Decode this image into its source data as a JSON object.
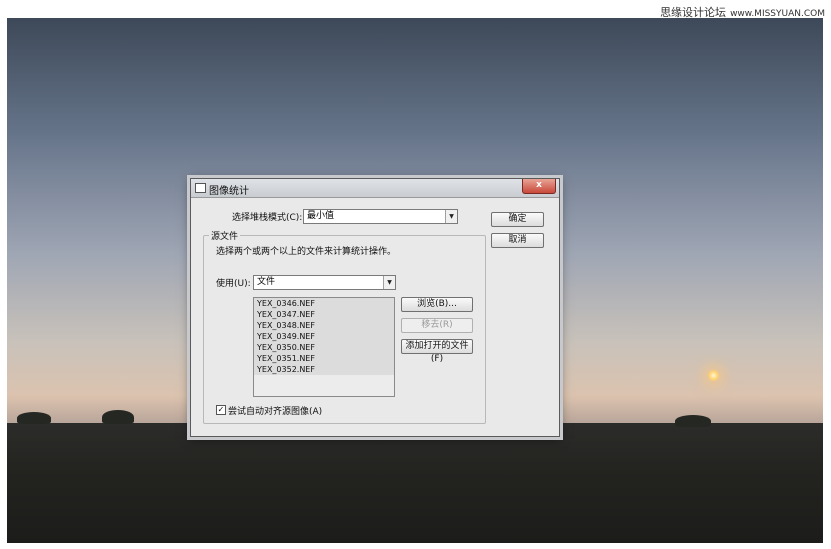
{
  "watermark": {
    "text": "思缘设计论坛",
    "site": "www.MISSYUAN.COM"
  },
  "dialog": {
    "title": "图像统计",
    "close_label": "x",
    "stack_mode_label": "选择堆栈模式(C):",
    "stack_mode_value": "最小值",
    "ok_label": "确定",
    "cancel_label": "取消",
    "source_group_title": "源文件",
    "source_hint": "选择两个或两个以上的文件来计算统计操作。",
    "use_label": "使用(U):",
    "use_value": "文件",
    "files": [
      "YEX_0346.NEF",
      "YEX_0347.NEF",
      "YEX_0348.NEF",
      "YEX_0349.NEF",
      "YEX_0350.NEF",
      "YEX_0351.NEF",
      "YEX_0352.NEF"
    ],
    "browse_label": "浏览(B)...",
    "remove_label": "移去(R)",
    "add_open_label": "添加打开的文件(F)",
    "auto_align_label": "尝试自动对齐源图像(A)",
    "auto_align_checked": true
  }
}
